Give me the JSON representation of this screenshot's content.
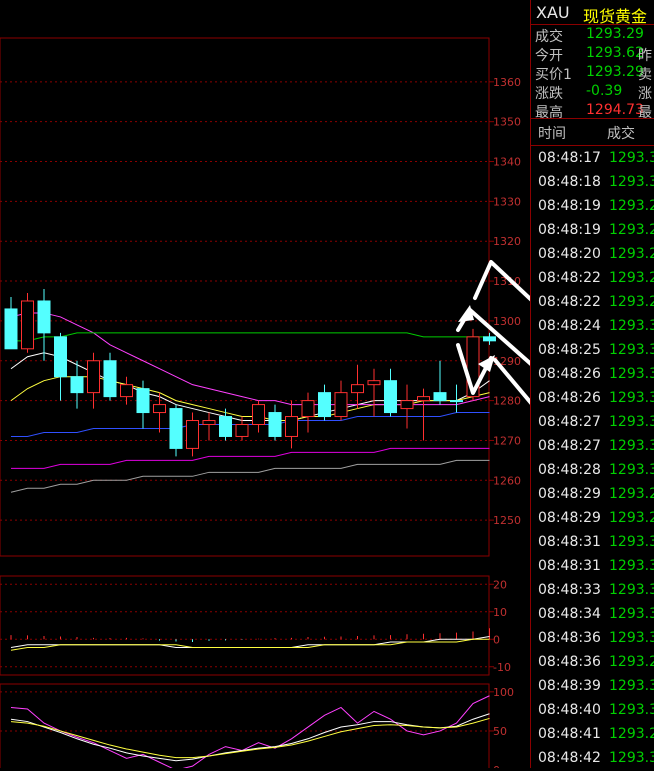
{
  "quote": {
    "symbol": "XAU",
    "name": "现货黄金",
    "rows": [
      {
        "label": "成交",
        "value": "1293.29",
        "color": "#00d000",
        "extra": ""
      },
      {
        "label": "今开",
        "value": "1293.62",
        "color": "#00d000",
        "extra": "昨"
      },
      {
        "label": "买价1",
        "value": "1293.29",
        "color": "#00d000",
        "extra": "卖"
      },
      {
        "label": "涨跌",
        "value": "-0.39",
        "color": "#00d000",
        "extra": "涨"
      },
      {
        "label": "最高",
        "value": "1294.73",
        "color": "#ff3030",
        "extra": "最"
      }
    ]
  },
  "ticks": {
    "header_time": "时间",
    "header_price": "成交",
    "rows": [
      {
        "time": "08:48:17",
        "price": "1293.3"
      },
      {
        "time": "08:48:18",
        "price": "1293.3"
      },
      {
        "time": "08:48:19",
        "price": "1293.2"
      },
      {
        "time": "08:48:19",
        "price": "1293.2"
      },
      {
        "time": "08:48:20",
        "price": "1293.2"
      },
      {
        "time": "08:48:22",
        "price": "1293.2"
      },
      {
        "time": "08:48:22",
        "price": "1293.2"
      },
      {
        "time": "08:48:24",
        "price": "1293.3"
      },
      {
        "time": "08:48:25",
        "price": "1293.3"
      },
      {
        "time": "08:48:26",
        "price": "1293.3"
      },
      {
        "time": "08:48:26",
        "price": "1293.3"
      },
      {
        "time": "08:48:27",
        "price": "1293.3"
      },
      {
        "time": "08:48:27",
        "price": "1293.3"
      },
      {
        "time": "08:48:28",
        "price": "1293.3"
      },
      {
        "time": "08:48:29",
        "price": "1293.2"
      },
      {
        "time": "08:48:29",
        "price": "1293.2"
      },
      {
        "time": "08:48:31",
        "price": "1293.3"
      },
      {
        "time": "08:48:31",
        "price": "1293.3"
      },
      {
        "time": "08:48:33",
        "price": "1293.3"
      },
      {
        "time": "08:48:34",
        "price": "1293.3"
      },
      {
        "time": "08:48:36",
        "price": "1293.3"
      },
      {
        "time": "08:48:36",
        "price": "1293.2"
      },
      {
        "time": "08:48:39",
        "price": "1293.3"
      },
      {
        "time": "08:48:40",
        "price": "1293.3"
      },
      {
        "time": "08:48:41",
        "price": "1293.2"
      },
      {
        "time": "08:48:42",
        "price": "1293.3"
      }
    ]
  },
  "chart_data": [
    {
      "type": "candlestick",
      "ylabels": [
        "1360",
        "1350",
        "1340",
        "1330",
        "1320",
        "1310",
        "1300",
        "1290",
        "1280",
        "1270",
        "1260",
        "1250"
      ],
      "ylim": [
        1241,
        1371
      ],
      "candles": [
        {
          "o": 1303,
          "h": 1306,
          "l": 1293,
          "c": 1293,
          "up": false
        },
        {
          "o": 1293,
          "h": 1307,
          "l": 1292,
          "c": 1305,
          "up": true
        },
        {
          "o": 1305,
          "h": 1308,
          "l": 1290,
          "c": 1297,
          "up": false
        },
        {
          "o": 1296,
          "h": 1297,
          "l": 1280,
          "c": 1286,
          "up": false
        },
        {
          "o": 1286,
          "h": 1290,
          "l": 1278,
          "c": 1282,
          "up": false
        },
        {
          "o": 1282,
          "h": 1292,
          "l": 1278,
          "c": 1290,
          "up": true
        },
        {
          "o": 1290,
          "h": 1292,
          "l": 1280,
          "c": 1281,
          "up": false
        },
        {
          "o": 1281,
          "h": 1286,
          "l": 1279,
          "c": 1284,
          "up": true
        },
        {
          "o": 1283,
          "h": 1285,
          "l": 1273,
          "c": 1277,
          "up": false
        },
        {
          "o": 1277,
          "h": 1282,
          "l": 1272,
          "c": 1279,
          "up": true
        },
        {
          "o": 1278,
          "h": 1279,
          "l": 1266,
          "c": 1268,
          "up": false
        },
        {
          "o": 1268,
          "h": 1277,
          "l": 1266,
          "c": 1275,
          "up": true
        },
        {
          "o": 1274,
          "h": 1277,
          "l": 1270,
          "c": 1275,
          "up": true
        },
        {
          "o": 1276,
          "h": 1278,
          "l": 1270,
          "c": 1271,
          "up": false
        },
        {
          "o": 1271,
          "h": 1276,
          "l": 1270,
          "c": 1274,
          "up": true
        },
        {
          "o": 1274,
          "h": 1280,
          "l": 1272,
          "c": 1279,
          "up": true
        },
        {
          "o": 1277,
          "h": 1279,
          "l": 1270,
          "c": 1271,
          "up": false
        },
        {
          "o": 1271,
          "h": 1280,
          "l": 1268,
          "c": 1276,
          "up": true
        },
        {
          "o": 1276,
          "h": 1282,
          "l": 1272,
          "c": 1280,
          "up": true
        },
        {
          "o": 1282,
          "h": 1284,
          "l": 1275,
          "c": 1276,
          "up": false
        },
        {
          "o": 1276,
          "h": 1285,
          "l": 1275,
          "c": 1282,
          "up": true
        },
        {
          "o": 1282,
          "h": 1289,
          "l": 1278,
          "c": 1284,
          "up": true
        },
        {
          "o": 1284,
          "h": 1288,
          "l": 1276,
          "c": 1285,
          "up": true
        },
        {
          "o": 1285,
          "h": 1288,
          "l": 1276,
          "c": 1277,
          "up": false
        },
        {
          "o": 1278,
          "h": 1284,
          "l": 1273,
          "c": 1280,
          "up": true
        },
        {
          "o": 1280,
          "h": 1283,
          "l": 1270,
          "c": 1281,
          "up": true
        },
        {
          "o": 1282,
          "h": 1290,
          "l": 1279,
          "c": 1280,
          "up": false
        },
        {
          "o": 1280,
          "h": 1284,
          "l": 1277,
          "c": 1280,
          "up": false
        },
        {
          "o": 1281,
          "h": 1298,
          "l": 1280,
          "c": 1296,
          "up": true
        },
        {
          "o": 1296,
          "h": 1297,
          "l": 1294,
          "c": 1295,
          "up": false
        }
      ],
      "ma": [
        {
          "color": "#ffffff",
          "values": [
            1288,
            1291,
            1292,
            1291,
            1289,
            1287,
            1285,
            1284,
            1282,
            1281,
            1279,
            1278,
            1277,
            1276,
            1275,
            1275,
            1275,
            1275,
            1276,
            1277,
            1278,
            1279,
            1280,
            1280,
            1280,
            1280,
            1280,
            1280,
            1282,
            1285
          ]
        },
        {
          "color": "#ffff40",
          "values": [
            1280,
            1283,
            1285,
            1286,
            1286,
            1286,
            1285,
            1284,
            1283,
            1282,
            1280,
            1279,
            1278,
            1277,
            1276,
            1276,
            1275,
            1275,
            1276,
            1276,
            1277,
            1278,
            1279,
            1279,
            1279,
            1280,
            1280,
            1280,
            1281,
            1282
          ]
        },
        {
          "color": "#ff40ff",
          "values": [
            1301,
            1302,
            1302,
            1301,
            1299,
            1297,
            1294,
            1292,
            1290,
            1288,
            1286,
            1284,
            1283,
            1282,
            1281,
            1280,
            1280,
            1279,
            1279,
            1279,
            1279,
            1279,
            1279,
            1279,
            1279,
            1279,
            1279,
            1279,
            1280,
            1281
          ]
        },
        {
          "color": "#00cc00",
          "values": [
            1295,
            1295,
            1296,
            1296,
            1297,
            1297,
            1297,
            1297,
            1297,
            1297,
            1297,
            1297,
            1297,
            1297,
            1297,
            1297,
            1297,
            1297,
            1297,
            1297,
            1297,
            1297,
            1297,
            1297,
            1297,
            1296,
            1296,
            1296,
            1296,
            1296
          ]
        },
        {
          "color": "#3050ff",
          "values": [
            1271,
            1271,
            1272,
            1272,
            1272,
            1273,
            1273,
            1273,
            1273,
            1273,
            1273,
            1274,
            1274,
            1274,
            1274,
            1274,
            1274,
            1275,
            1275,
            1275,
            1275,
            1276,
            1276,
            1276,
            1276,
            1276,
            1276,
            1277,
            1277,
            1277
          ]
        },
        {
          "color": "#e000e0",
          "values": [
            1263,
            1263,
            1263,
            1264,
            1264,
            1264,
            1264,
            1265,
            1265,
            1265,
            1265,
            1265,
            1266,
            1266,
            1266,
            1266,
            1266,
            1267,
            1267,
            1267,
            1267,
            1267,
            1267,
            1268,
            1268,
            1268,
            1268,
            1268,
            1268,
            1268
          ]
        },
        {
          "color": "#a0a0a0",
          "values": [
            1257,
            1258,
            1258,
            1259,
            1259,
            1260,
            1260,
            1260,
            1261,
            1261,
            1261,
            1261,
            1262,
            1262,
            1262,
            1262,
            1263,
            1263,
            1263,
            1263,
            1263,
            1264,
            1264,
            1264,
            1264,
            1264,
            1264,
            1265,
            1265,
            1265
          ]
        }
      ]
    },
    {
      "type": "bar",
      "ylabels": [
        "20",
        "10",
        "0",
        "-10"
      ],
      "ylim": [
        -13,
        23
      ],
      "bars": [
        1.5,
        1.4,
        1.2,
        1.0,
        0.8,
        0.5,
        0.4,
        0.5,
        0.3,
        -0.5,
        -0.8,
        -1.0,
        -0.6,
        -0.4,
        -0.2,
        0.2,
        0.4,
        0.5,
        0.8,
        0.9,
        1.0,
        1.2,
        1.4,
        1.5,
        1.8,
        2.0,
        2.2,
        2.4,
        2.8,
        4.0
      ],
      "lines": [
        {
          "color": "#ffffff",
          "values": [
            -3,
            -2,
            -2,
            -2,
            -2,
            -2,
            -2,
            -2,
            -2,
            -2,
            -3,
            -3,
            -3,
            -3,
            -3,
            -3,
            -3,
            -3,
            -2,
            -2,
            -2,
            -2,
            -2,
            -1,
            -1,
            -1,
            0,
            0,
            0,
            1
          ]
        },
        {
          "color": "#ffff40",
          "values": [
            -4,
            -3,
            -3,
            -2,
            -2,
            -2,
            -2,
            -2,
            -2,
            -2,
            -2,
            -3,
            -3,
            -3,
            -3,
            -3,
            -3,
            -3,
            -3,
            -2,
            -2,
            -2,
            -2,
            -2,
            -1,
            -1,
            -1,
            -1,
            0,
            0
          ]
        }
      ]
    },
    {
      "type": "line",
      "ylabels": [
        "100",
        "50",
        "0"
      ],
      "ylim": [
        -5,
        110
      ],
      "lines": [
        {
          "color": "#ff40ff",
          "values": [
            80,
            78,
            60,
            50,
            42,
            35,
            25,
            15,
            20,
            10,
            0,
            5,
            20,
            30,
            25,
            35,
            28,
            40,
            55,
            70,
            80,
            60,
            75,
            65,
            50,
            45,
            50,
            60,
            85,
            95
          ]
        },
        {
          "color": "#ffffff",
          "values": [
            65,
            62,
            55,
            48,
            40,
            33,
            28,
            22,
            18,
            15,
            12,
            14,
            18,
            22,
            25,
            28,
            30,
            34,
            40,
            48,
            55,
            58,
            62,
            62,
            58,
            55,
            54,
            56,
            65,
            72
          ]
        },
        {
          "color": "#ffff40",
          "values": [
            62,
            60,
            56,
            50,
            44,
            38,
            32,
            27,
            23,
            19,
            16,
            16,
            18,
            21,
            24,
            27,
            29,
            32,
            37,
            43,
            49,
            53,
            57,
            58,
            57,
            55,
            54,
            55,
            60,
            66
          ]
        }
      ]
    }
  ]
}
